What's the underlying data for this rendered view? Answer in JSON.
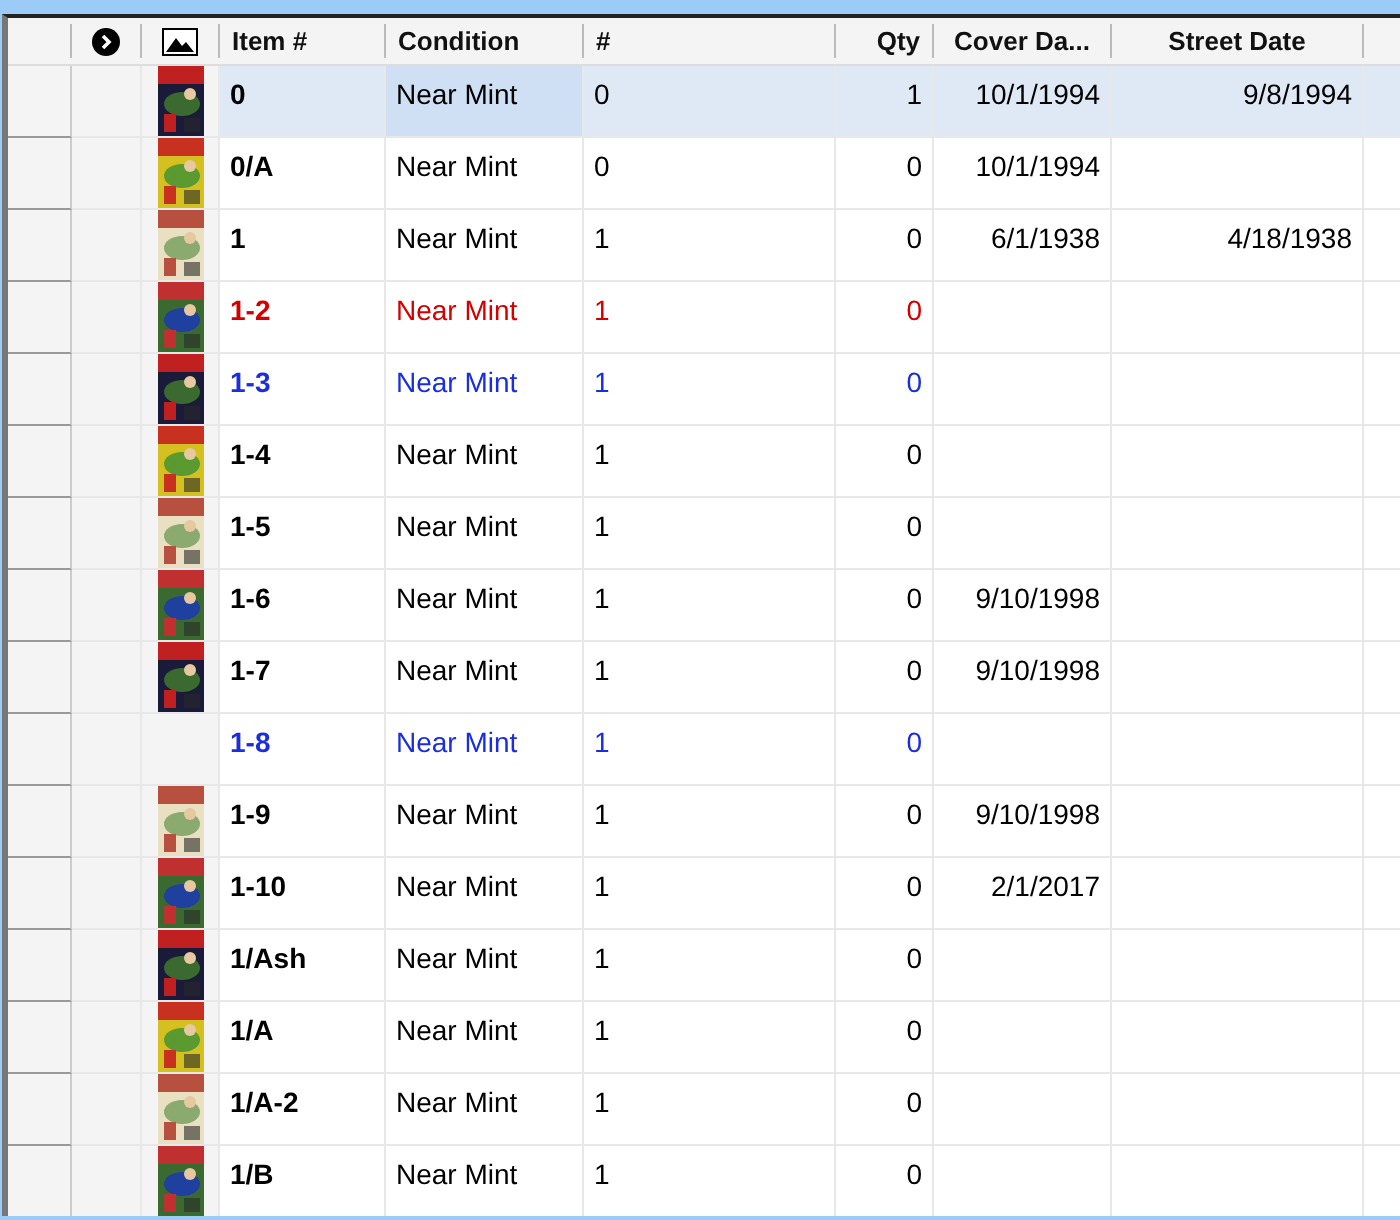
{
  "columns": [
    "Item #",
    "Condition",
    "#",
    "Qty",
    "Cover Da...",
    "Street Date"
  ],
  "rows": [
    {
      "item": "0",
      "condition": "Near Mint",
      "number": "0",
      "qty": "1",
      "cover_date": "10/1/1994",
      "street_date": "9/8/1994",
      "color": "#000000",
      "selected": true
    },
    {
      "item": "0/A",
      "condition": "Near Mint",
      "number": "0",
      "qty": "0",
      "cover_date": "10/1/1994",
      "color": "#000000",
      "selected": false
    },
    {
      "item": "1",
      "condition": "Near Mint",
      "number": "1",
      "qty": "0",
      "cover_date": "6/1/1938",
      "street_date": "4/18/1938",
      "color": "#000000",
      "selected": false
    },
    {
      "item": "1-2",
      "condition": "Near Mint",
      "number": "1",
      "qty": "0",
      "color": "#d40000",
      "selected": false
    },
    {
      "item": "1-3",
      "condition": "Near Mint",
      "number": "1",
      "qty": "0",
      "color": "#1a2ee0",
      "selected": false
    },
    {
      "item": "1-4",
      "condition": "Near Mint",
      "number": "1",
      "qty": "0",
      "color": "#000000",
      "selected": false
    },
    {
      "item": "1-5",
      "condition": "Near Mint",
      "number": "1",
      "qty": "0",
      "color": "#000000",
      "selected": false
    },
    {
      "item": "1-6",
      "condition": "Near Mint",
      "number": "1",
      "qty": "0",
      "cover_date": "9/10/1998",
      "color": "#000000",
      "selected": false
    },
    {
      "item": "1-7",
      "condition": "Near Mint",
      "number": "1",
      "qty": "0",
      "cover_date": "9/10/1998",
      "color": "#000000",
      "selected": false
    },
    {
      "item": "1-8",
      "condition": "Near Mint",
      "number": "1",
      "qty": "0",
      "color": "#1a2ee0",
      "selected": false
    },
    {
      "item": "1-9",
      "condition": "Near Mint",
      "number": "1",
      "qty": "0",
      "cover_date": "9/10/1998",
      "color": "#000000",
      "selected": false
    },
    {
      "item": "1-10",
      "condition": "Near Mint",
      "number": "1",
      "qty": "0",
      "cover_date": "2/1/2017",
      "color": "#000000",
      "selected": false
    },
    {
      "item": "1/Ash",
      "condition": "Near Mint",
      "number": "1",
      "qty": "0",
      "color": "#000000",
      "selected": false
    },
    {
      "item": "1/A",
      "condition": "Near Mint",
      "number": "1",
      "qty": "0",
      "color": "#000000",
      "selected": false
    },
    {
      "item": "1/A-2",
      "condition": "Near Mint",
      "number": "1",
      "qty": "0",
      "color": "#000000",
      "selected": false
    },
    {
      "item": "1/B",
      "condition": "Near Mint",
      "number": "1",
      "qty": "0",
      "color": "#000000",
      "selected": false
    }
  ]
}
